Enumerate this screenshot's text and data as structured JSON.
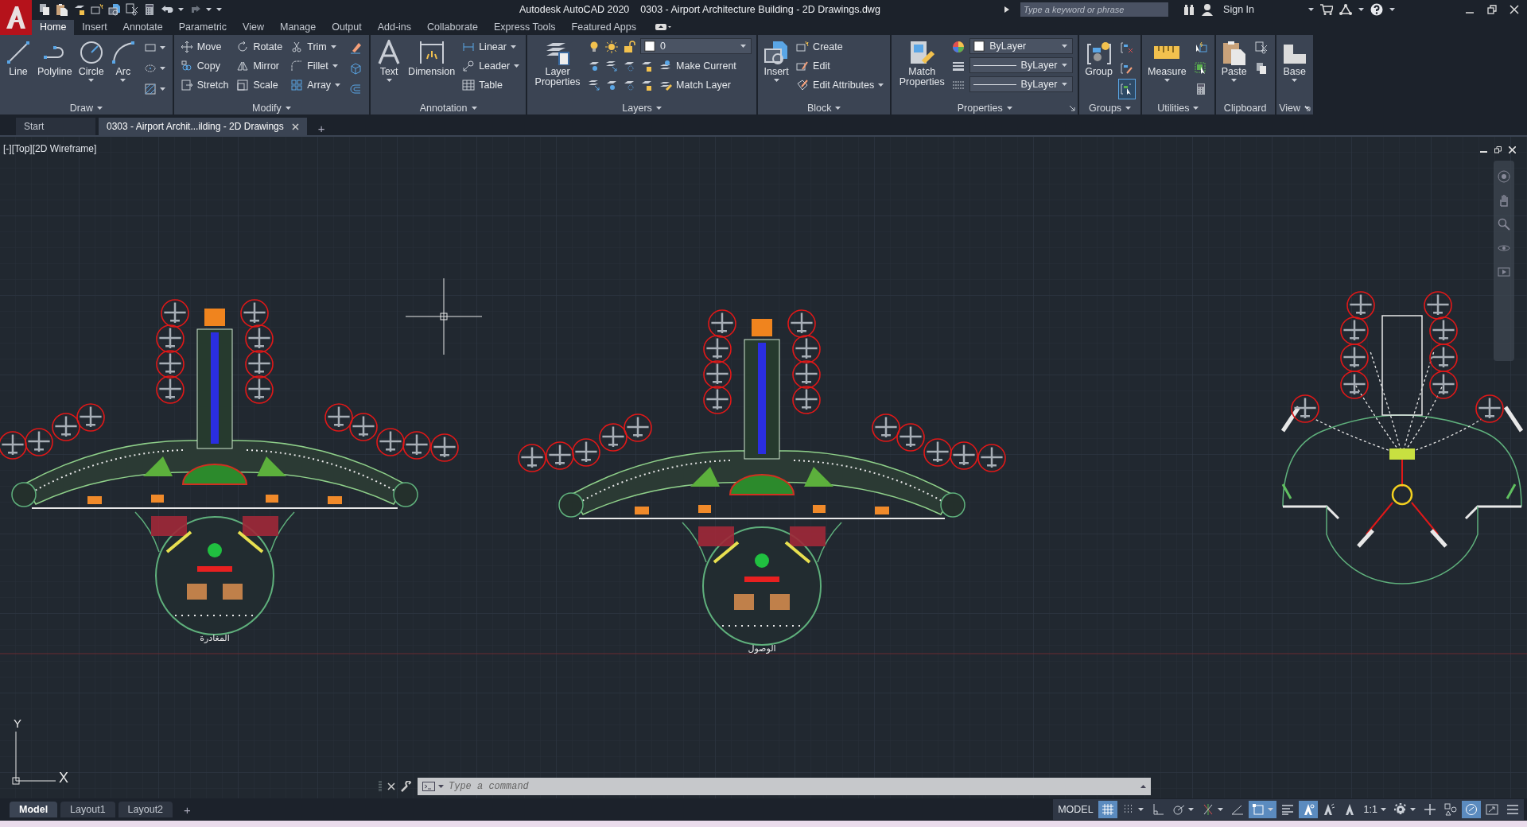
{
  "title_bar": {
    "app_name": "Autodesk AutoCAD 2020",
    "document": "0303 - Airport Architecture Building - 2D Drawings.dwg",
    "search": {
      "placeholder": "Type a keyword or phrase"
    },
    "sign_in": "Sign In"
  },
  "ribbon_tabs": [
    {
      "label": "Home",
      "selected": true
    },
    {
      "label": "Insert",
      "selected": false
    },
    {
      "label": "Annotate",
      "selected": false
    },
    {
      "label": "Parametric",
      "selected": false
    },
    {
      "label": "View",
      "selected": false
    },
    {
      "label": "Manage",
      "selected": false
    },
    {
      "label": "Output",
      "selected": false
    },
    {
      "label": "Add-ins",
      "selected": false
    },
    {
      "label": "Collaborate",
      "selected": false
    },
    {
      "label": "Express Tools",
      "selected": false
    },
    {
      "label": "Featured Apps",
      "selected": false
    }
  ],
  "ribbon_panels": [
    {
      "title": "Draw",
      "title_caret": true,
      "launcher": false,
      "columns": [
        [
          {
            "kind": "large",
            "label": "Line",
            "caret": false
          }
        ],
        [
          {
            "kind": "large",
            "label": "Polyline",
            "caret": false
          }
        ],
        [
          {
            "kind": "large",
            "label": "Circle",
            "caret": true
          }
        ],
        [
          {
            "kind": "large",
            "label": "Arc",
            "caret": true
          }
        ],
        [
          {
            "kind": "icon",
            "caret": true
          },
          {
            "kind": "icon",
            "caret": true
          },
          {
            "kind": "icon",
            "caret": true
          }
        ]
      ]
    },
    {
      "title": "Modify",
      "title_caret": true,
      "launcher": false,
      "columns": [
        [
          {
            "kind": "small",
            "label": "Move",
            "caret": false
          },
          {
            "kind": "small",
            "label": "Copy",
            "caret": false
          },
          {
            "kind": "small",
            "label": "Stretch",
            "caret": false
          }
        ],
        [
          {
            "kind": "small",
            "label": "Rotate",
            "caret": false
          },
          {
            "kind": "small",
            "label": "Mirror",
            "caret": false
          },
          {
            "kind": "small",
            "label": "Scale",
            "caret": false
          }
        ],
        [
          {
            "kind": "small",
            "label": "Trim",
            "caret": true
          },
          {
            "kind": "small",
            "label": "Fillet",
            "caret": true
          },
          {
            "kind": "small",
            "label": "Array",
            "caret": true
          }
        ],
        [
          {
            "kind": "icon",
            "caret": false
          },
          {
            "kind": "icon",
            "caret": false
          },
          {
            "kind": "icon",
            "caret": false
          }
        ]
      ]
    },
    {
      "title": "Annotation",
      "title_caret": true,
      "launcher": false,
      "columns": [
        [
          {
            "kind": "large",
            "label": "Text",
            "caret": true
          }
        ],
        [
          {
            "kind": "large",
            "label": "Dimension",
            "caret": false
          }
        ],
        [
          {
            "kind": "small",
            "label": "Linear",
            "caret": true
          },
          {
            "kind": "small",
            "label": "Leader",
            "caret": true
          },
          {
            "kind": "small",
            "label": "Table",
            "caret": false
          }
        ]
      ]
    },
    {
      "title": "Layers",
      "title_caret": true,
      "launcher": false,
      "columns": [
        [
          {
            "kind": "large",
            "label": "Layer Properties",
            "caret": false
          }
        ],
        [
          {
            "kind": "layer-combo",
            "value": "0"
          },
          {
            "kind": "layer-row",
            "label": "Make Current"
          },
          {
            "kind": "layer-row",
            "label": "Match Layer"
          }
        ]
      ]
    },
    {
      "title": "Block",
      "title_caret": true,
      "launcher": false,
      "columns": [
        [
          {
            "kind": "large",
            "label": "Insert",
            "caret": true
          }
        ],
        [
          {
            "kind": "small",
            "label": "Create",
            "caret": false
          },
          {
            "kind": "small",
            "label": "Edit",
            "caret": false
          },
          {
            "kind": "small",
            "label": "Edit Attributes",
            "caret": true
          }
        ]
      ]
    },
    {
      "title": "Properties",
      "title_caret": true,
      "launcher": true,
      "columns": [
        [
          {
            "kind": "large",
            "label": "Match Properties",
            "caret": false
          }
        ],
        [
          {
            "kind": "color-combo",
            "value": "ByLayer"
          },
          {
            "kind": "line-combo",
            "value": "ByLayer"
          },
          {
            "kind": "line-combo",
            "value": "ByLayer"
          }
        ]
      ]
    },
    {
      "title": "Groups",
      "title_caret": true,
      "launcher": false,
      "columns": [
        [
          {
            "kind": "large",
            "label": "Group",
            "caret": false
          }
        ],
        [
          {
            "kind": "icon",
            "caret": false,
            "on": false
          },
          {
            "kind": "icon",
            "caret": false,
            "on": false
          },
          {
            "kind": "icon",
            "caret": false,
            "on": true
          }
        ]
      ]
    },
    {
      "title": "Utilities",
      "title_caret": true,
      "launcher": false,
      "columns": [
        [
          {
            "kind": "large",
            "label": "Measure",
            "caret": true
          }
        ],
        [
          {
            "kind": "icon",
            "caret": false
          },
          {
            "kind": "icon",
            "caret": false
          },
          {
            "kind": "icon",
            "caret": false
          }
        ]
      ]
    },
    {
      "title": "Clipboard",
      "title_caret": false,
      "launcher": false,
      "columns": [
        [
          {
            "kind": "large",
            "label": "Paste",
            "caret": true
          }
        ],
        [
          {
            "kind": "icon",
            "caret": false
          },
          {
            "kind": "icon",
            "caret": false
          }
        ]
      ]
    },
    {
      "title": "View",
      "title_caret": true,
      "launcher": true,
      "columns": [
        [
          {
            "kind": "large",
            "label": "Base",
            "caret": true
          }
        ]
      ]
    }
  ],
  "document_tabs": [
    {
      "label": "Start",
      "selected": false,
      "closable": false
    },
    {
      "label": "0303 - Airport Archit...ilding - 2D Drawings",
      "selected": true,
      "closable": true
    }
  ],
  "new_tab": "+",
  "viewport": {
    "controls": [
      "[-]",
      "[Top]",
      "[2D Wireframe]"
    ],
    "ucs": {
      "y": "Y",
      "x": "X"
    },
    "plans": [
      {
        "kind": "terminal",
        "label": "المغادرة"
      },
      {
        "kind": "terminal",
        "label": "الوصول"
      },
      {
        "kind": "satellite"
      }
    ]
  },
  "command_line": {
    "placeholder": "Type a command"
  },
  "layout_tabs": [
    {
      "label": "Model",
      "selected": true
    },
    {
      "label": "Layout1",
      "selected": false
    },
    {
      "label": "Layout2",
      "selected": false
    }
  ],
  "new_layout": "+",
  "status_bar": [
    {
      "kind": "text",
      "label": "MODEL",
      "caret": false
    },
    {
      "kind": "toggle",
      "on": true,
      "caret": false
    },
    {
      "kind": "toggle",
      "on": false,
      "caret": true
    },
    {
      "kind": "toggle",
      "on": false,
      "caret": false
    },
    {
      "kind": "toggle",
      "on": false,
      "caret": true
    },
    {
      "kind": "toggle",
      "on": false,
      "caret": true
    },
    {
      "kind": "toggle",
      "on": false,
      "caret": false
    },
    {
      "kind": "toggle",
      "on": true,
      "caret": true
    },
    {
      "kind": "toggle",
      "on": false,
      "caret": false
    },
    {
      "kind": "toggle",
      "on": true,
      "caret": false
    },
    {
      "kind": "toggle",
      "on": false,
      "caret": false
    },
    {
      "kind": "toggle",
      "on": false,
      "caret": false
    },
    {
      "kind": "text",
      "label": "1:1",
      "caret": true
    },
    {
      "kind": "toggle",
      "on": false,
      "caret": true
    },
    {
      "kind": "toggle",
      "on": false,
      "caret": false
    },
    {
      "kind": "toggle",
      "on": false,
      "caret": false
    },
    {
      "kind": "toggle",
      "on": true,
      "caret": false
    },
    {
      "kind": "toggle",
      "on": false,
      "caret": false
    },
    {
      "kind": "toggle",
      "on": false,
      "caret": false
    }
  ]
}
